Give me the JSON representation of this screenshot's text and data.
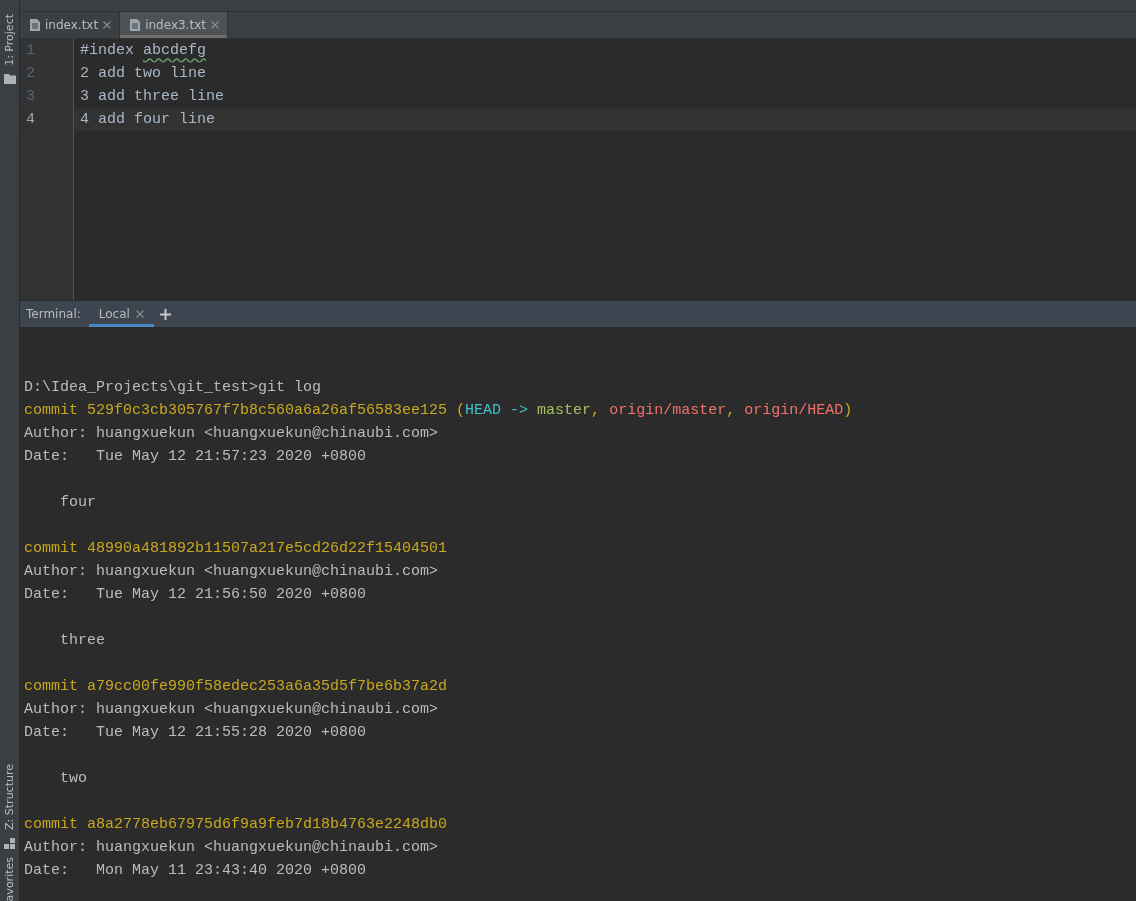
{
  "side_strip": {
    "top_items": [
      {
        "label": "1: Project"
      }
    ],
    "bottom_items": [
      {
        "label": "Z: Structure"
      },
      {
        "label": "avorites"
      }
    ]
  },
  "editor_tabs": [
    {
      "label": "index.txt",
      "selected": false
    },
    {
      "label": "index3.txt",
      "selected": true
    }
  ],
  "editor": {
    "lines": [
      {
        "number": "1",
        "current": false,
        "segments": [
          {
            "text": "#index ",
            "misspelled": false
          },
          {
            "text": "abcdefg",
            "misspelled": true
          }
        ]
      },
      {
        "number": "2",
        "current": false,
        "segments": [
          {
            "text": "2 add two line",
            "misspelled": false
          }
        ]
      },
      {
        "number": "3",
        "current": false,
        "segments": [
          {
            "text": "3 add three line",
            "misspelled": false
          }
        ]
      },
      {
        "number": "4",
        "current": true,
        "segments": [
          {
            "text": "4 add four line",
            "misspelled": false
          }
        ]
      }
    ]
  },
  "terminal": {
    "title": "Terminal:",
    "tabs": [
      {
        "label": "Local",
        "selected": true
      }
    ],
    "lines": [
      {
        "kind": "blank"
      },
      {
        "kind": "blank"
      },
      {
        "kind": "text",
        "segments": [
          {
            "text": "D:\\Idea_Projects\\git_test>git log",
            "kind": "plain"
          }
        ]
      },
      {
        "kind": "text",
        "segments": [
          {
            "text": "commit 529f0c3cb305767f7b8c560a6a26af56583ee125 (",
            "kind": "commit"
          },
          {
            "text": "HEAD -> ",
            "kind": "head"
          },
          {
            "text": "master",
            "kind": "branch"
          },
          {
            "text": ", ",
            "kind": "commit"
          },
          {
            "text": "origin/master",
            "kind": "remote"
          },
          {
            "text": ", ",
            "kind": "commit"
          },
          {
            "text": "origin/HEAD",
            "kind": "remote"
          },
          {
            "text": ")",
            "kind": "commit"
          }
        ]
      },
      {
        "kind": "text",
        "segments": [
          {
            "text": "Author: huangxuekun <huangxuekun@chinaubi.com>",
            "kind": "plain"
          }
        ]
      },
      {
        "kind": "text",
        "segments": [
          {
            "text": "Date:   Tue May 12 21:57:23 2020 +0800",
            "kind": "plain"
          }
        ]
      },
      {
        "kind": "blank"
      },
      {
        "kind": "text",
        "segments": [
          {
            "text": "    four",
            "kind": "plain"
          }
        ]
      },
      {
        "kind": "blank"
      },
      {
        "kind": "text",
        "segments": [
          {
            "text": "commit 48990a481892b11507a217e5cd26d22f15404501",
            "kind": "commit"
          }
        ]
      },
      {
        "kind": "text",
        "segments": [
          {
            "text": "Author: huangxuekun <huangxuekun@chinaubi.com>",
            "kind": "plain"
          }
        ]
      },
      {
        "kind": "text",
        "segments": [
          {
            "text": "Date:   Tue May 12 21:56:50 2020 +0800",
            "kind": "plain"
          }
        ]
      },
      {
        "kind": "blank"
      },
      {
        "kind": "text",
        "segments": [
          {
            "text": "    three",
            "kind": "plain"
          }
        ]
      },
      {
        "kind": "blank"
      },
      {
        "kind": "text",
        "segments": [
          {
            "text": "commit a79cc00fe990f58edec253a6a35d5f7be6b37a2d",
            "kind": "commit"
          }
        ]
      },
      {
        "kind": "text",
        "segments": [
          {
            "text": "Author: huangxuekun <huangxuekun@chinaubi.com>",
            "kind": "plain"
          }
        ]
      },
      {
        "kind": "text",
        "segments": [
          {
            "text": "Date:   Tue May 12 21:55:28 2020 +0800",
            "kind": "plain"
          }
        ]
      },
      {
        "kind": "blank"
      },
      {
        "kind": "text",
        "segments": [
          {
            "text": "    two",
            "kind": "plain"
          }
        ]
      },
      {
        "kind": "blank"
      },
      {
        "kind": "text",
        "segments": [
          {
            "text": "commit a8a2778eb67975d6f9a9feb7d18b4763e2248db0",
            "kind": "commit"
          }
        ]
      },
      {
        "kind": "text",
        "segments": [
          {
            "text": "Author: huangxuekun <huangxuekun@chinaubi.com>",
            "kind": "plain"
          }
        ]
      },
      {
        "kind": "text",
        "segments": [
          {
            "text": "Date:   Mon May 11 23:43:40 2020 +0800",
            "kind": "plain"
          }
        ]
      }
    ]
  }
}
